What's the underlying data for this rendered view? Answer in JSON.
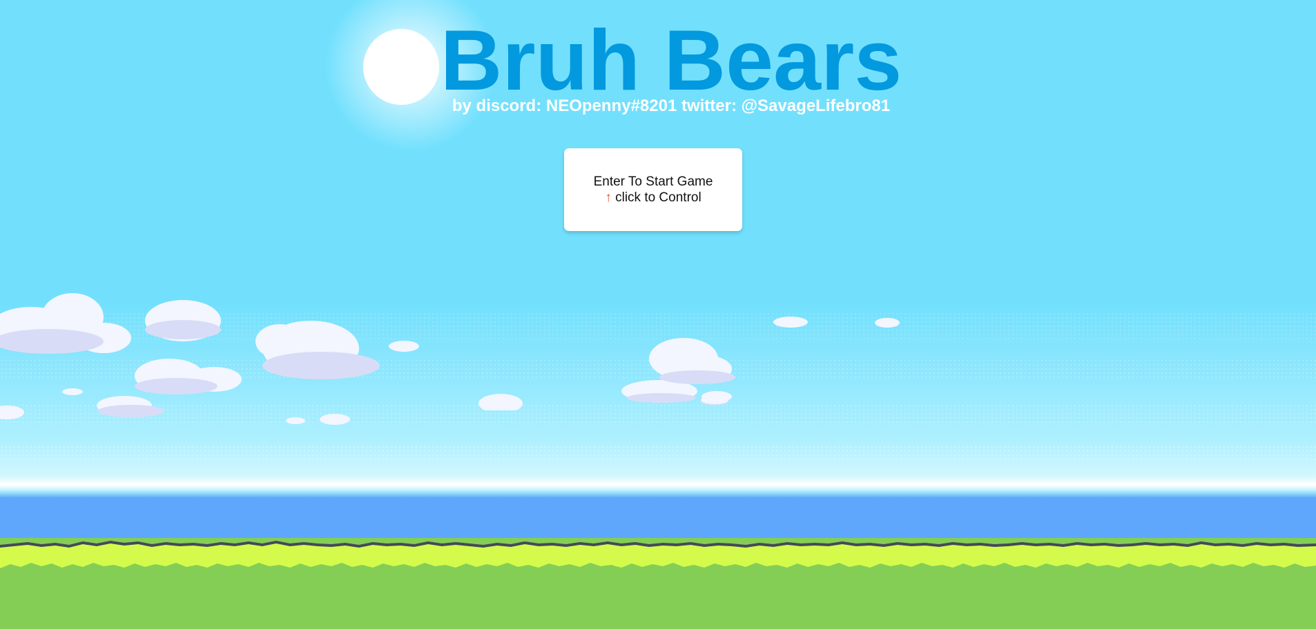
{
  "title": "Bruh Bears",
  "subtitle": "by discord: NEOpenny#8201 twitter: @SavageLifebro81",
  "start_card": {
    "line1": "Enter To Start Game",
    "arrow": "↑",
    "line2": " click to Control"
  },
  "colors": {
    "title": "#0399df",
    "sky": "#72e0fd",
    "water": "#5ea7fd",
    "grass_light": "#d4fb4c",
    "grass": "#84ce55",
    "arrow": "#e8452c"
  },
  "icons": {
    "sun": "sun-icon",
    "clouds": "cloud-icon",
    "arrow": "arrow-up-icon"
  }
}
